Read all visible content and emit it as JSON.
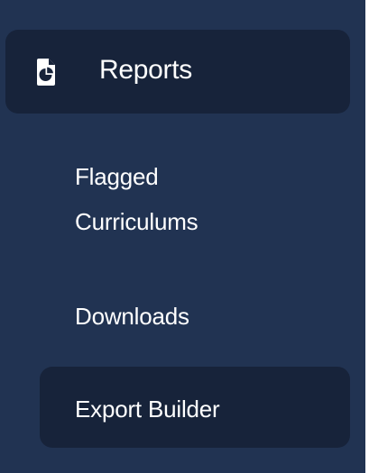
{
  "sidebar": {
    "section": {
      "label": "Reports",
      "icon": "report-document-icon"
    },
    "items": [
      {
        "label_line1": "Flagged",
        "label_line2": "Curriculums"
      },
      {
        "label": "Downloads"
      },
      {
        "label": "Export Builder",
        "active": true
      }
    ]
  },
  "colors": {
    "sidebar_bg": "#213352",
    "active_bg": "#17233a",
    "text": "#ffffff"
  }
}
